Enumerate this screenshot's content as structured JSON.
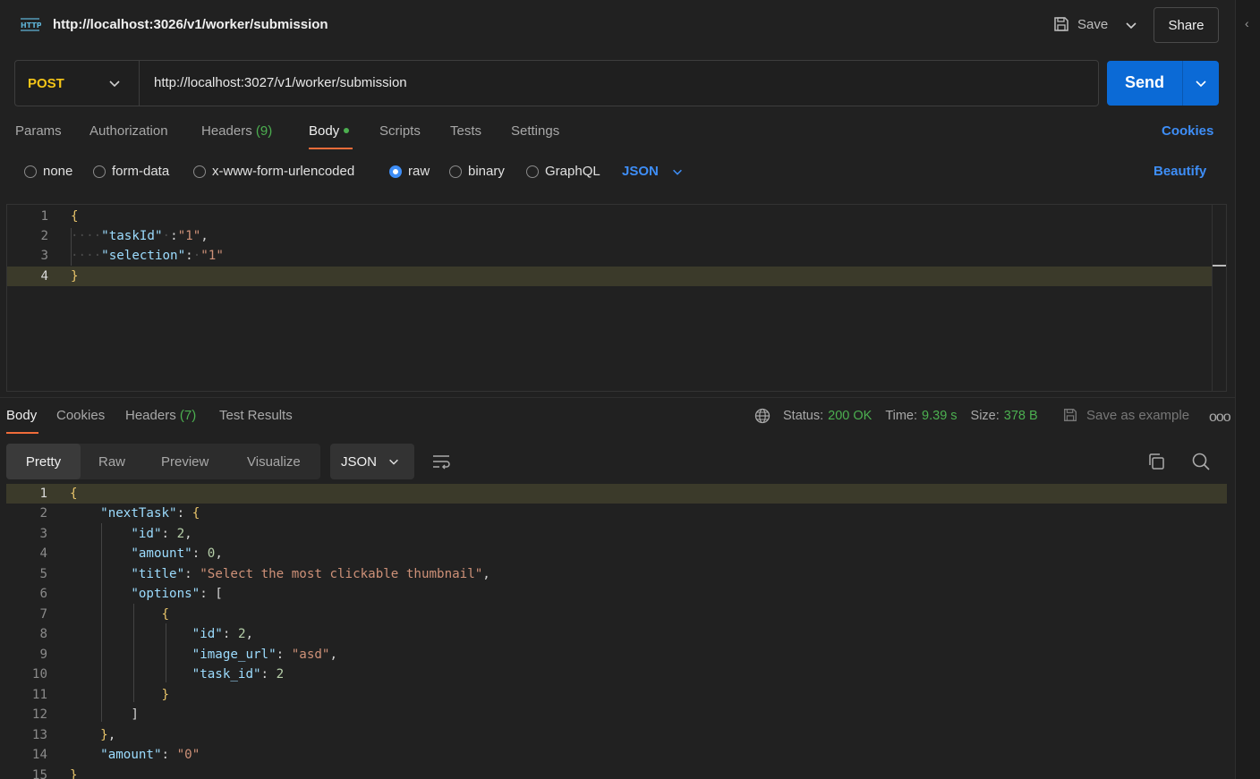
{
  "topbar": {
    "request_title": "http://localhost:3026/v1/worker/submission",
    "save_label": "Save",
    "share_label": "Share"
  },
  "request": {
    "method": "POST",
    "url": "http://localhost:3027/v1/worker/submission",
    "send_label": "Send"
  },
  "request_tabs": {
    "params": "Params",
    "authorization": "Authorization",
    "headers": "Headers",
    "headers_count": "(9)",
    "body": "Body",
    "scripts": "Scripts",
    "tests": "Tests",
    "settings": "Settings",
    "cookies": "Cookies"
  },
  "body_types": {
    "none": "none",
    "form_data": "form-data",
    "urlencoded": "x-www-form-urlencoded",
    "raw": "raw",
    "binary": "binary",
    "graphql": "GraphQL",
    "selected": "raw",
    "format": "JSON",
    "beautify": "Beautify"
  },
  "request_body": {
    "line_numbers": [
      "1",
      "2",
      "3",
      "4"
    ],
    "line1": "{",
    "key_taskId": "\"taskId\"",
    "val_taskId": "\"1\"",
    "key_selection": "\"selection\"",
    "val_selection": "\"1\"",
    "line4": "}"
  },
  "response_tabs": {
    "body": "Body",
    "cookies": "Cookies",
    "headers": "Headers",
    "headers_count": "(7)",
    "test_results": "Test Results"
  },
  "response_status": {
    "status_label": "Status:",
    "status_value": "200 OK",
    "time_label": "Time:",
    "time_value": "9.39 s",
    "size_label": "Size:",
    "size_value": "378 B",
    "save_example": "Save as example"
  },
  "response_view": {
    "pretty": "Pretty",
    "raw": "Raw",
    "preview": "Preview",
    "visualize": "Visualize",
    "format": "JSON"
  },
  "response_body": {
    "line_numbers": [
      "1",
      "2",
      "3",
      "4",
      "5",
      "6",
      "7",
      "8",
      "9",
      "10",
      "11",
      "12",
      "13",
      "14",
      "15"
    ],
    "k_nextTask": "\"nextTask\"",
    "k_id": "\"id\"",
    "v_id": "2",
    "k_amount": "\"amount\"",
    "v_amount": "0",
    "k_title": "\"title\"",
    "v_title": "\"Select the most clickable thumbnail\"",
    "k_options": "\"options\"",
    "k_opt_id": "\"id\"",
    "v_opt_id": "2",
    "k_image_url": "\"image_url\"",
    "v_image_url": "\"asd\"",
    "k_task_id": "\"task_id\"",
    "v_task_id": "2",
    "k_amount2": "\"amount\"",
    "v_amount2": "\"0\""
  }
}
